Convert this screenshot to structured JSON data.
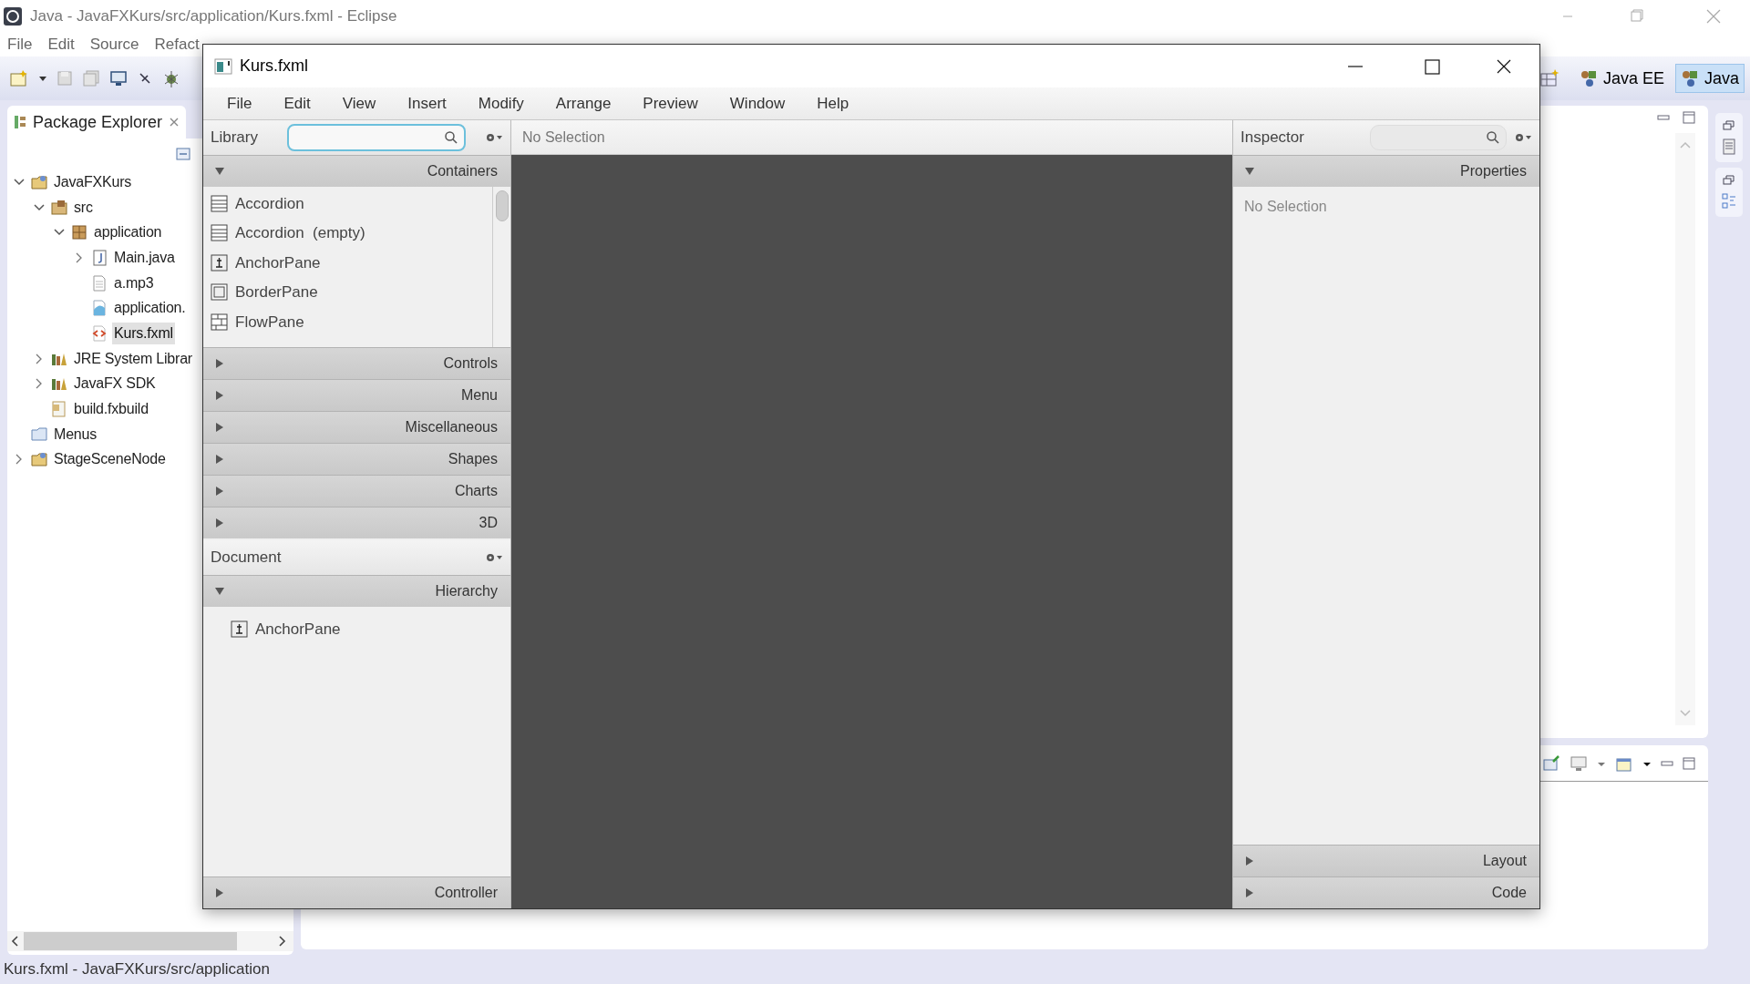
{
  "eclipse": {
    "title": "Java - JavaFXKurs/src/application/Kurs.fxml - Eclipse",
    "menu": [
      "File",
      "Edit",
      "Source",
      "Refact"
    ],
    "perspectives": [
      {
        "label": "Java EE",
        "selected": false
      },
      {
        "label": "Java",
        "selected": true
      }
    ],
    "package_explorer": {
      "title": "Package Explorer",
      "tree": [
        {
          "label": "JavaFXKurs",
          "kind": "project",
          "expanded": true,
          "selected": false,
          "children": [
            {
              "label": "src",
              "kind": "source",
              "expanded": true,
              "selected": false,
              "children": [
                {
                  "label": "application",
                  "kind": "package",
                  "expanded": true,
                  "selected": false,
                  "children": [
                    {
                      "label": "Main.java",
                      "kind": "java",
                      "expanded": false,
                      "selected": false
                    },
                    {
                      "label": "a.mp3",
                      "kind": "file",
                      "selected": false
                    },
                    {
                      "label": "application.",
                      "kind": "css",
                      "selected": false
                    },
                    {
                      "label": "Kurs.fxml",
                      "kind": "fxml",
                      "selected": true
                    }
                  ]
                }
              ]
            },
            {
              "label": "JRE System Librar",
              "kind": "library",
              "expanded": false,
              "selected": false
            },
            {
              "label": "JavaFX SDK",
              "kind": "library",
              "expanded": false,
              "selected": false
            },
            {
              "label": "build.fxbuild",
              "kind": "build",
              "selected": false
            }
          ]
        },
        {
          "label": "Menus",
          "kind": "folder",
          "selected": false
        },
        {
          "label": "StageSceneNode",
          "kind": "project",
          "expanded": false,
          "selected": false
        }
      ]
    },
    "status_bar": "Kurs.fxml - JavaFXKurs/src/application"
  },
  "scene_builder": {
    "title": "Kurs.fxml",
    "menu": [
      "File",
      "Edit",
      "View",
      "Insert",
      "Modify",
      "Arrange",
      "Preview",
      "Window",
      "Help"
    ],
    "library": {
      "title": "Library",
      "sections": [
        {
          "label": "Containers",
          "expanded": true,
          "items": [
            {
              "label": "Accordion",
              "kind": "accordion"
            },
            {
              "label": "Accordion  (empty)",
              "kind": "accordion"
            },
            {
              "label": "AnchorPane",
              "kind": "anchor"
            },
            {
              "label": "BorderPane",
              "kind": "border"
            },
            {
              "label": "FlowPane",
              "kind": "flow"
            }
          ]
        },
        {
          "label": "Controls",
          "expanded": false
        },
        {
          "label": "Menu",
          "expanded": false
        },
        {
          "label": "Miscellaneous",
          "expanded": false
        },
        {
          "label": "Shapes",
          "expanded": false
        },
        {
          "label": "Charts",
          "expanded": false
        },
        {
          "label": "3D",
          "expanded": false
        }
      ]
    },
    "document": {
      "title": "Document",
      "sections": [
        {
          "label": "Hierarchy",
          "expanded": true,
          "items": [
            {
              "label": "AnchorPane",
              "kind": "anchor"
            }
          ]
        },
        {
          "label": "Controller",
          "expanded": false
        }
      ]
    },
    "canvas": {
      "selection": "No Selection"
    },
    "inspector": {
      "title": "Inspector",
      "sections": [
        {
          "label": "Properties",
          "expanded": true,
          "text": "No Selection"
        },
        {
          "label": "Layout",
          "expanded": false
        },
        {
          "label": "Code",
          "expanded": false
        }
      ]
    }
  }
}
